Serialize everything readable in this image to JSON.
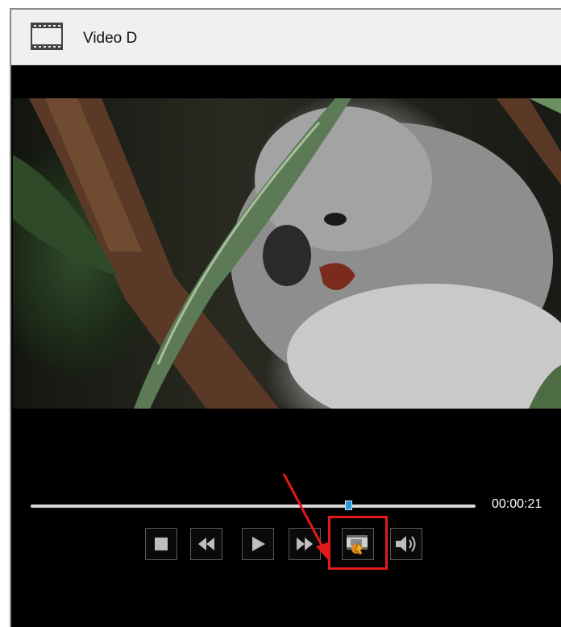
{
  "window": {
    "title": "Video D"
  },
  "player": {
    "current_time": "00:00:21",
    "progress_fraction": 0.715
  },
  "controls": [
    {
      "id": "stop",
      "icon": "stop-icon"
    },
    {
      "id": "rewind",
      "icon": "rewind-icon"
    },
    {
      "id": "play",
      "icon": "play-icon"
    },
    {
      "id": "fast-forward",
      "icon": "fast-forward-icon"
    },
    {
      "id": "snapshot",
      "icon": "snapshot-icon",
      "highlighted": true
    },
    {
      "id": "volume",
      "icon": "speaker-icon"
    }
  ],
  "colors": {
    "annotation": "#e21a1a",
    "slider_thumb": "#2f97d6"
  }
}
